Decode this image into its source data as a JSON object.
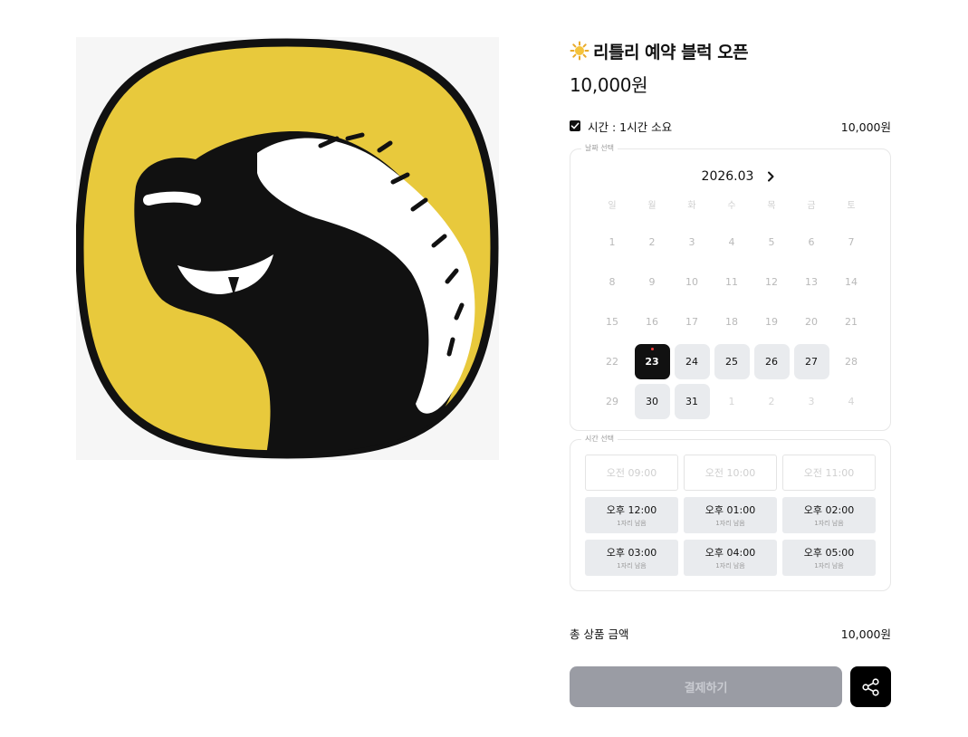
{
  "product": {
    "title": "리틀리 예약 블럭 오픈",
    "price": "10,000원",
    "image_icon": "dog-logo-image"
  },
  "option": {
    "checked": true,
    "label": "시간 : 1시간 소요",
    "price": "10,000원"
  },
  "date_picker": {
    "legend": "날짜 선택",
    "month": "2026.03",
    "next_icon": "chevron-right-icon",
    "weekdays": [
      "일",
      "월",
      "화",
      "수",
      "목",
      "금",
      "토"
    ],
    "days": [
      {
        "d": "1",
        "s": "disabled"
      },
      {
        "d": "2",
        "s": "disabled"
      },
      {
        "d": "3",
        "s": "disabled"
      },
      {
        "d": "4",
        "s": "disabled"
      },
      {
        "d": "5",
        "s": "disabled"
      },
      {
        "d": "6",
        "s": "disabled"
      },
      {
        "d": "7",
        "s": "disabled"
      },
      {
        "d": "8",
        "s": "disabled"
      },
      {
        "d": "9",
        "s": "disabled"
      },
      {
        "d": "10",
        "s": "disabled"
      },
      {
        "d": "11",
        "s": "disabled"
      },
      {
        "d": "12",
        "s": "disabled"
      },
      {
        "d": "13",
        "s": "disabled"
      },
      {
        "d": "14",
        "s": "disabled"
      },
      {
        "d": "15",
        "s": "disabled"
      },
      {
        "d": "16",
        "s": "disabled"
      },
      {
        "d": "17",
        "s": "disabled"
      },
      {
        "d": "18",
        "s": "disabled"
      },
      {
        "d": "19",
        "s": "disabled"
      },
      {
        "d": "20",
        "s": "disabled"
      },
      {
        "d": "21",
        "s": "disabled"
      },
      {
        "d": "22",
        "s": "disabled"
      },
      {
        "d": "23",
        "s": "selected",
        "today": true
      },
      {
        "d": "24",
        "s": "available"
      },
      {
        "d": "25",
        "s": "available"
      },
      {
        "d": "26",
        "s": "available"
      },
      {
        "d": "27",
        "s": "available"
      },
      {
        "d": "28",
        "s": "disabled"
      },
      {
        "d": "29",
        "s": "disabled"
      },
      {
        "d": "30",
        "s": "available"
      },
      {
        "d": "31",
        "s": "available"
      },
      {
        "d": "1",
        "s": "outside"
      },
      {
        "d": "2",
        "s": "outside"
      },
      {
        "d": "3",
        "s": "outside"
      },
      {
        "d": "4",
        "s": "outside"
      }
    ]
  },
  "time_picker": {
    "legend": "시간 선택",
    "slots": [
      {
        "time": "오전 09:00",
        "remaining": "",
        "available": false
      },
      {
        "time": "오전 10:00",
        "remaining": "",
        "available": false
      },
      {
        "time": "오전 11:00",
        "remaining": "",
        "available": false
      },
      {
        "time": "오후 12:00",
        "remaining": "1자리 남음",
        "available": true
      },
      {
        "time": "오후 01:00",
        "remaining": "1자리 남음",
        "available": true
      },
      {
        "time": "오후 02:00",
        "remaining": "1자리 남음",
        "available": true
      },
      {
        "time": "오후 03:00",
        "remaining": "1자리 남음",
        "available": true
      },
      {
        "time": "오후 04:00",
        "remaining": "1자리 남음",
        "available": true
      },
      {
        "time": "오후 05:00",
        "remaining": "1자리 남음",
        "available": true
      }
    ]
  },
  "summary": {
    "total_label": "총 상품 금액",
    "total_value": "10,000원"
  },
  "actions": {
    "pay_label": "결제하기",
    "share_icon": "share-icon"
  },
  "colors": {
    "logo_yellow": "#E8C93C",
    "primary_dark": "#111111",
    "disabled_button": "#9A9CA4",
    "today_dot": "#FF3B3B"
  }
}
